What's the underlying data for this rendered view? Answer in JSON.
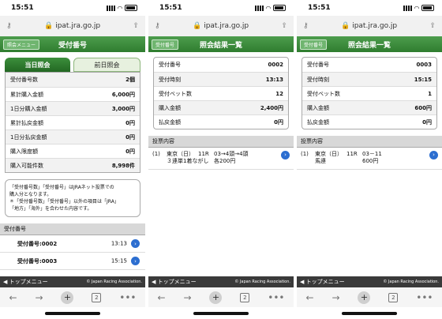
{
  "panels": {
    "left": {
      "time": "15:51",
      "url": "ipat.jra.go.jp",
      "back_label": "照会メニュー",
      "title": "受付番号",
      "tabs": [
        {
          "label": "当日照会",
          "active": true
        },
        {
          "label": "前日照会",
          "active": false
        }
      ],
      "rows": [
        {
          "label": "受付番号数",
          "value": "2個"
        },
        {
          "label": "累計購入金額",
          "value": "6,000円"
        },
        {
          "label": "1日分購入金額",
          "value": "3,000円"
        },
        {
          "label": "累計払戻金額",
          "value": "0円"
        },
        {
          "label": "1日分払戻金額",
          "value": "0円"
        },
        {
          "label": "購入限度額",
          "value": "0円"
        },
        {
          "label": "購入可能件数",
          "value": "8,998件"
        }
      ],
      "note_lines": [
        "「受付番号数」「受付番号」はJRAネット投票での",
        "購入分となります。",
        "＊「受付番号数」「受付番号」以外の項目は「JRA」",
        "「地方」「海外」を合わせた内容です。"
      ],
      "section": "受付番号",
      "receipts": [
        {
          "label": "受付番号:0002",
          "time": "13:13"
        },
        {
          "label": "受付番号:0003",
          "time": "15:15"
        }
      ],
      "bottom_menu": "◀ トップメニュー",
      "copyright": "© Japan Racing Association."
    },
    "mid": {
      "time": "15:51",
      "url": "ipat.jra.go.jp",
      "back_label": "受付番号",
      "title": "照会結果一覧",
      "rows": [
        {
          "label": "受付番号",
          "value": "0002"
        },
        {
          "label": "受付時刻",
          "value": "13:13"
        },
        {
          "label": "受付ベット数",
          "value": "12"
        },
        {
          "label": "購入金額",
          "value": "2,400円"
        },
        {
          "label": "払戻金額",
          "value": "0円"
        }
      ],
      "section": "投票内容",
      "detail": {
        "num": "(1)",
        "venue": "東京（日）",
        "race": "11R",
        "combo": "03→4頭→4頭",
        "type": "３連単1着ながし",
        "amount": "各200円"
      },
      "bottom_menu": "◀ トップメニュー",
      "copyright": "© Japan Racing Association."
    },
    "right": {
      "time": "15:51",
      "url": "ipat.jra.go.jp",
      "back_label": "受付番号",
      "title": "照会結果一覧",
      "rows": [
        {
          "label": "受付番号",
          "value": "0003"
        },
        {
          "label": "受付時刻",
          "value": "15:15"
        },
        {
          "label": "受付ベット数",
          "value": "1"
        },
        {
          "label": "購入金額",
          "value": "600円"
        },
        {
          "label": "払戻金額",
          "value": "0円"
        }
      ],
      "section": "投票内容",
      "detail": {
        "num": "(1)",
        "venue": "東京（日）",
        "race": "11R",
        "combo": "03－11",
        "type": "馬連",
        "amount": "600円"
      },
      "bottom_menu": "◀ トップメニュー",
      "copyright": "© Japan Racing Association."
    }
  },
  "browser": {
    "tab_count": "2",
    "back_icon": "back-arrow-icon",
    "forward_icon": "forward-arrow-icon",
    "new_tab_icon": "plus-icon",
    "more_icon": "more-icon"
  }
}
